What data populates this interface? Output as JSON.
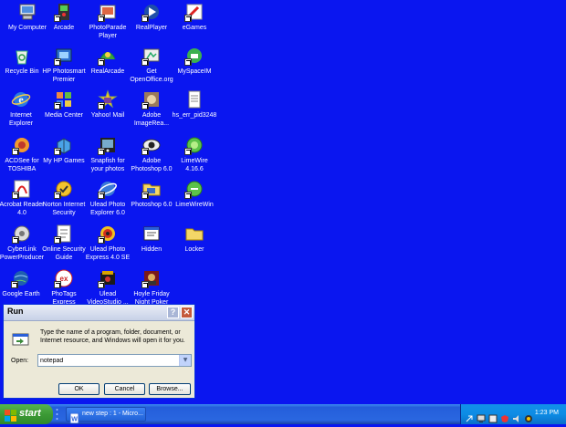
{
  "desktop": {
    "icons": [
      {
        "label": "My Computer"
      },
      {
        "label": "Recycle Bin"
      },
      {
        "label": "Internet\nExplorer"
      },
      {
        "label": "ACDSee for\nTOSHIBA"
      },
      {
        "label": "Acrobat Reader\n4.0"
      },
      {
        "label": "CyberLink\nPowerProducer"
      },
      {
        "label": "Google Earth"
      },
      {
        "label": "Arcade"
      },
      {
        "label": "HP Photosmart\nPremier"
      },
      {
        "label": "Media Center"
      },
      {
        "label": "My HP Games"
      },
      {
        "label": "Norton Internet\nSecurity"
      },
      {
        "label": "Online Security\nGuide"
      },
      {
        "label": "PhoTags\nExpress"
      },
      {
        "label": "PhotoParade\nPlayer"
      },
      {
        "label": "RealArcade"
      },
      {
        "label": "Yahoo! Mail"
      },
      {
        "label": "Snapfish for\nyour photos"
      },
      {
        "label": "Ulead Photo\nExplorer 6.0"
      },
      {
        "label": "Ulead Photo\nExpress 4.0 SE"
      },
      {
        "label": "Ulead\nVideoStudio ..."
      },
      {
        "label": "RealPlayer"
      },
      {
        "label": "Get\nOpenOffice.org"
      },
      {
        "label": "Adobe\nImageRea..."
      },
      {
        "label": "Adobe\nPhotoshop 6.0"
      },
      {
        "label": "Photoshop 6.0"
      },
      {
        "label": "Hidden"
      },
      {
        "label": "Hoyle Friday\nNight Poker"
      },
      {
        "label": "eGames"
      },
      {
        "label": "MySpaceIM"
      },
      {
        "label": "hs_err_pid3248"
      },
      {
        "label": "LimeWire\n4.16.6"
      },
      {
        "label": "LimeWireWin"
      },
      {
        "label": "Locker"
      }
    ]
  },
  "run_dialog": {
    "title": "Run",
    "help_glyph": "?",
    "close_glyph": "✕",
    "description": "Type the name of a program, folder, document, or Internet resource, and Windows will open it for you.",
    "open_label": "Open:",
    "open_value": "notepad",
    "dropdown_glyph": "▼",
    "ok_label": "OK",
    "cancel_label": "Cancel",
    "browse_label": "Browse..."
  },
  "taskbar": {
    "start_label": "start",
    "task_label": "new step : 1 - Micro...",
    "clock": "1:23 PM"
  },
  "colors": {
    "desktop": "#0a16f0",
    "taskbar": "#245edb",
    "start": "#3c9a36",
    "tray": "#0d8ce5"
  }
}
